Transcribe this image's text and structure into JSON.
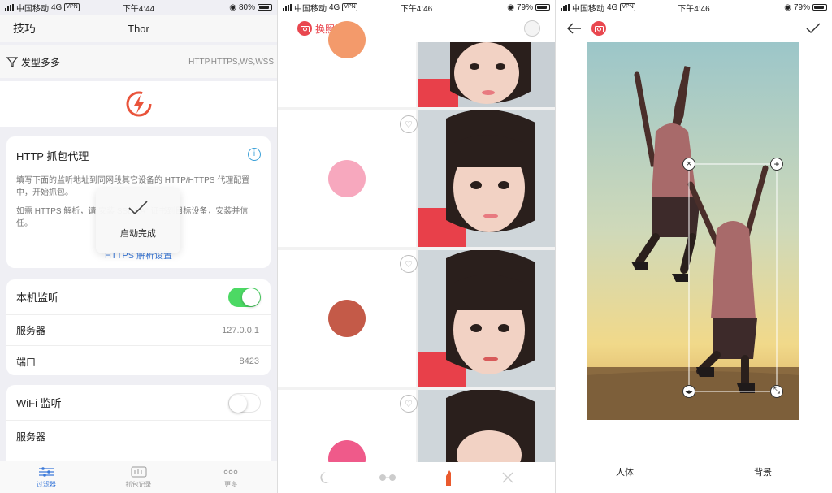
{
  "screen1": {
    "status": {
      "carrier": "中国移动",
      "network": "4G",
      "vpn": "VPN",
      "time": "下午4:44",
      "battery": "80%"
    },
    "nav": {
      "left": "技巧",
      "title": "Thor"
    },
    "filter": {
      "label": "发型多多",
      "protocols": "HTTP,HTTPS,WS,WSS"
    },
    "proxy_card": {
      "title": "HTTP 抓包代理",
      "desc1": "填写下面的监听地址到同网段其它设备的 HTTP/HTTPS 代理配置中，开始抓包。",
      "desc2": "如需 HTTPS 解析，请 安装 SSL CA\" 证书到目标设备，安装并信任。",
      "link": "HTTPS 解析设置"
    },
    "toast": {
      "text": "启动完成"
    },
    "local": {
      "title": "本机监听",
      "server_label": "服务器",
      "server_value": "127.0.0.1",
      "port_label": "端口",
      "port_value": "8423",
      "enabled": true
    },
    "wifi": {
      "title": "WiFi 监听",
      "server_label": "服务器",
      "enabled": false
    },
    "tabs": [
      "过滤器",
      "抓包记录",
      "更多"
    ]
  },
  "screen2": {
    "status": {
      "carrier": "中国移动",
      "network": "4G",
      "vpn": "VPN",
      "time": "下午4:46",
      "battery": "79%"
    },
    "nav": {
      "title": "换照片"
    },
    "swatches": [
      "#f39a6b",
      "#f7a8be",
      "#c45a48",
      "#ef5a8a"
    ]
  },
  "screen3": {
    "status": {
      "carrier": "中国移动",
      "network": "4G",
      "vpn": "VPN",
      "time": "下午4:46",
      "battery": "79%"
    },
    "tabs": [
      "人体",
      "背景"
    ]
  }
}
